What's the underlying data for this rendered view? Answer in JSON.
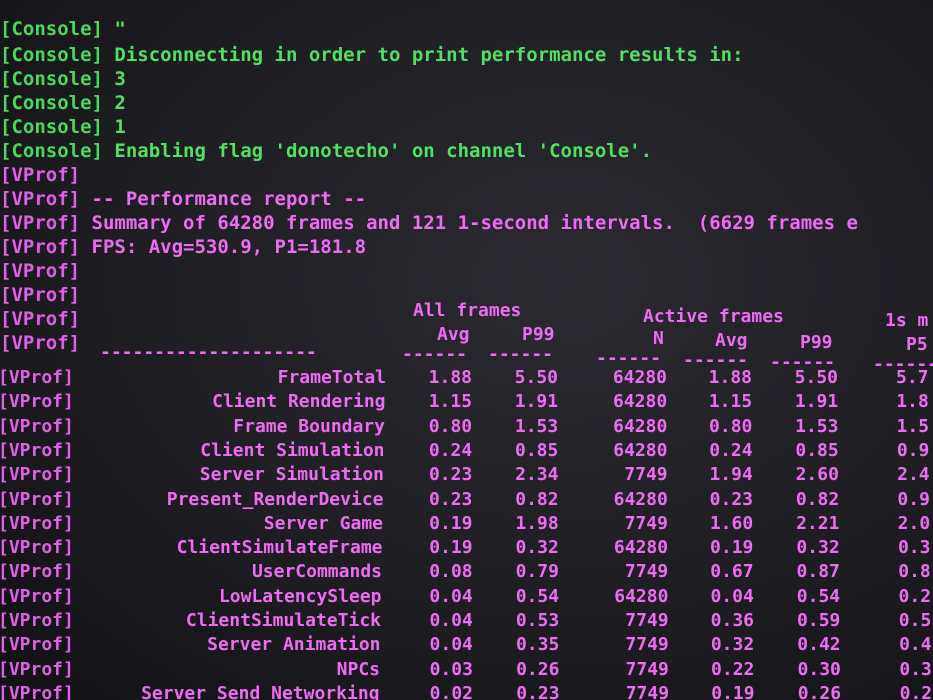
{
  "console": {
    "tag": "[Console]",
    "lines": [
      "\"",
      "Disconnecting in order to print performance results in:",
      "3",
      "2",
      "1",
      "Enabling flag 'donotecho' on channel 'Console'."
    ]
  },
  "vprof": {
    "tag": "[VProf]",
    "perf_report": "-- Performance report --",
    "summary": "Summary of 64280 frames and 121 1-second intervals.  (6629 frames e",
    "fps": "FPS: Avg=530.9, P1=181.8",
    "headers": {
      "all_frames": "All frames",
      "active_frames": "Active frames",
      "one_s": "1s m",
      "avg": "Avg",
      "p99": "P99",
      "n": "N",
      "p50": "P5"
    },
    "dashes": {
      "name": "--------------------",
      "short": "------"
    },
    "rows": [
      {
        "name": "FrameTotal",
        "avg": "1.88",
        "p99": "5.50",
        "n": "64280",
        "act_avg": "1.88",
        "act_p99": "5.50",
        "p5": "5.7"
      },
      {
        "name": "Client Rendering",
        "avg": "1.15",
        "p99": "1.91",
        "n": "64280",
        "act_avg": "1.15",
        "act_p99": "1.91",
        "p5": "1.8"
      },
      {
        "name": "Frame Boundary",
        "avg": "0.80",
        "p99": "1.53",
        "n": "64280",
        "act_avg": "0.80",
        "act_p99": "1.53",
        "p5": "1.5"
      },
      {
        "name": "Client Simulation",
        "avg": "0.24",
        "p99": "0.85",
        "n": "64280",
        "act_avg": "0.24",
        "act_p99": "0.85",
        "p5": "0.9"
      },
      {
        "name": "Server Simulation",
        "avg": "0.23",
        "p99": "2.34",
        "n": "7749",
        "act_avg": "1.94",
        "act_p99": "2.60",
        "p5": "2.4"
      },
      {
        "name": "Present_RenderDevice",
        "avg": "0.23",
        "p99": "0.82",
        "n": "64280",
        "act_avg": "0.23",
        "act_p99": "0.82",
        "p5": "0.9"
      },
      {
        "name": "Server Game",
        "avg": "0.19",
        "p99": "1.98",
        "n": "7749",
        "act_avg": "1.60",
        "act_p99": "2.21",
        "p5": "2.0"
      },
      {
        "name": "ClientSimulateFrame",
        "avg": "0.19",
        "p99": "0.32",
        "n": "64280",
        "act_avg": "0.19",
        "act_p99": "0.32",
        "p5": "0.3"
      },
      {
        "name": "UserCommands",
        "avg": "0.08",
        "p99": "0.79",
        "n": "7749",
        "act_avg": "0.67",
        "act_p99": "0.87",
        "p5": "0.8"
      },
      {
        "name": "LowLatencySleep",
        "avg": "0.04",
        "p99": "0.54",
        "n": "64280",
        "act_avg": "0.04",
        "act_p99": "0.54",
        "p5": "0.2"
      },
      {
        "name": "ClientSimulateTick",
        "avg": "0.04",
        "p99": "0.53",
        "n": "7749",
        "act_avg": "0.36",
        "act_p99": "0.59",
        "p5": "0.5"
      },
      {
        "name": "Server Animation",
        "avg": "0.04",
        "p99": "0.35",
        "n": "7749",
        "act_avg": "0.32",
        "act_p99": "0.42",
        "p5": "0.4"
      },
      {
        "name": "NPCs",
        "avg": "0.03",
        "p99": "0.26",
        "n": "7749",
        "act_avg": "0.22",
        "act_p99": "0.30",
        "p5": "0.3"
      },
      {
        "name": "Server Send Networking",
        "avg": "0.02",
        "p99": "0.23",
        "n": "7749",
        "act_avg": "0.19",
        "act_p99": "0.26",
        "p5": "0.2"
      }
    ]
  }
}
